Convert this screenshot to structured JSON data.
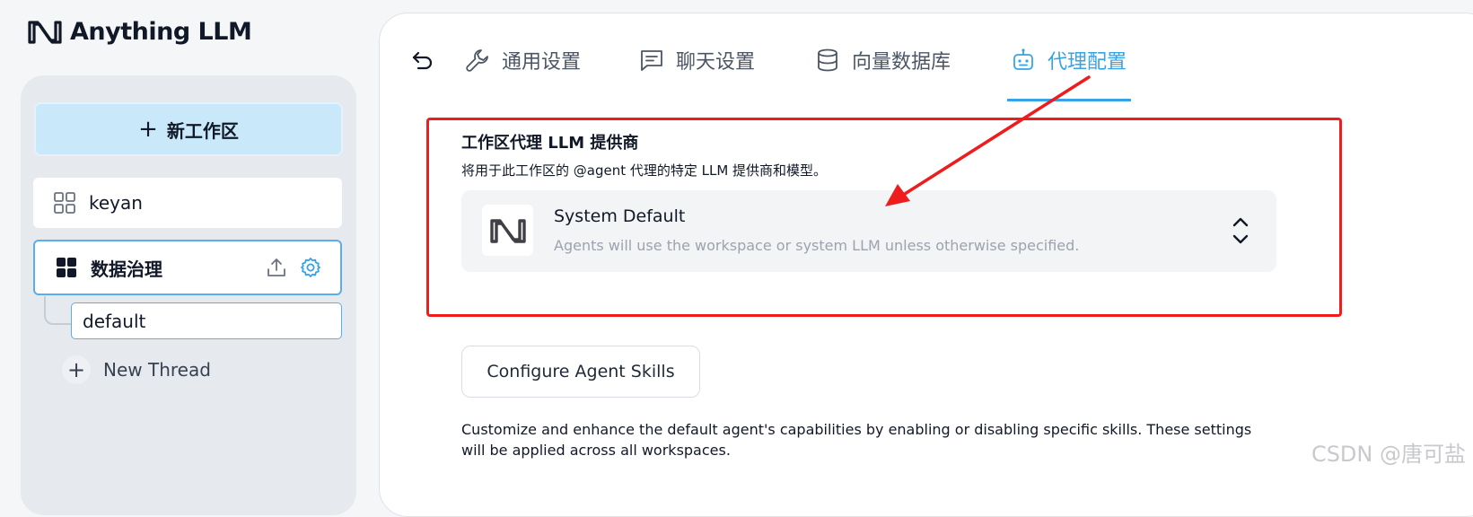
{
  "app": {
    "name": "Anything LLM"
  },
  "sidebar": {
    "new_workspace_label": "新工作区",
    "workspaces": [
      {
        "name": "keyan"
      },
      {
        "name": "数据治理",
        "active": true
      }
    ],
    "threads": [
      {
        "name": "default"
      }
    ],
    "new_thread_label": "New Thread"
  },
  "tabs": [
    {
      "label": "通用设置",
      "icon": "wrench-icon"
    },
    {
      "label": "聊天设置",
      "icon": "chat-icon"
    },
    {
      "label": "向量数据库",
      "icon": "database-icon"
    },
    {
      "label": "代理配置",
      "icon": "robot-icon",
      "active": true
    }
  ],
  "agent_llm": {
    "title": "工作区代理 LLM 提供商",
    "description": "将用于此工作区的 @agent 代理的特定 LLM 提供商和模型。",
    "provider_name": "System Default",
    "provider_desc": "Agents will use the workspace or system LLM unless otherwise specified."
  },
  "skills": {
    "button_label": "Configure Agent Skills",
    "description": "Customize and enhance the default agent's capabilities by enabling or disabling specific skills. These settings will be applied across all workspaces."
  },
  "watermark": "CSDN @唐可盐",
  "colors": {
    "accent": "#36a3e6",
    "annotation_red": "#ee1c1c",
    "new_button_bg": "#c9e9fb"
  }
}
